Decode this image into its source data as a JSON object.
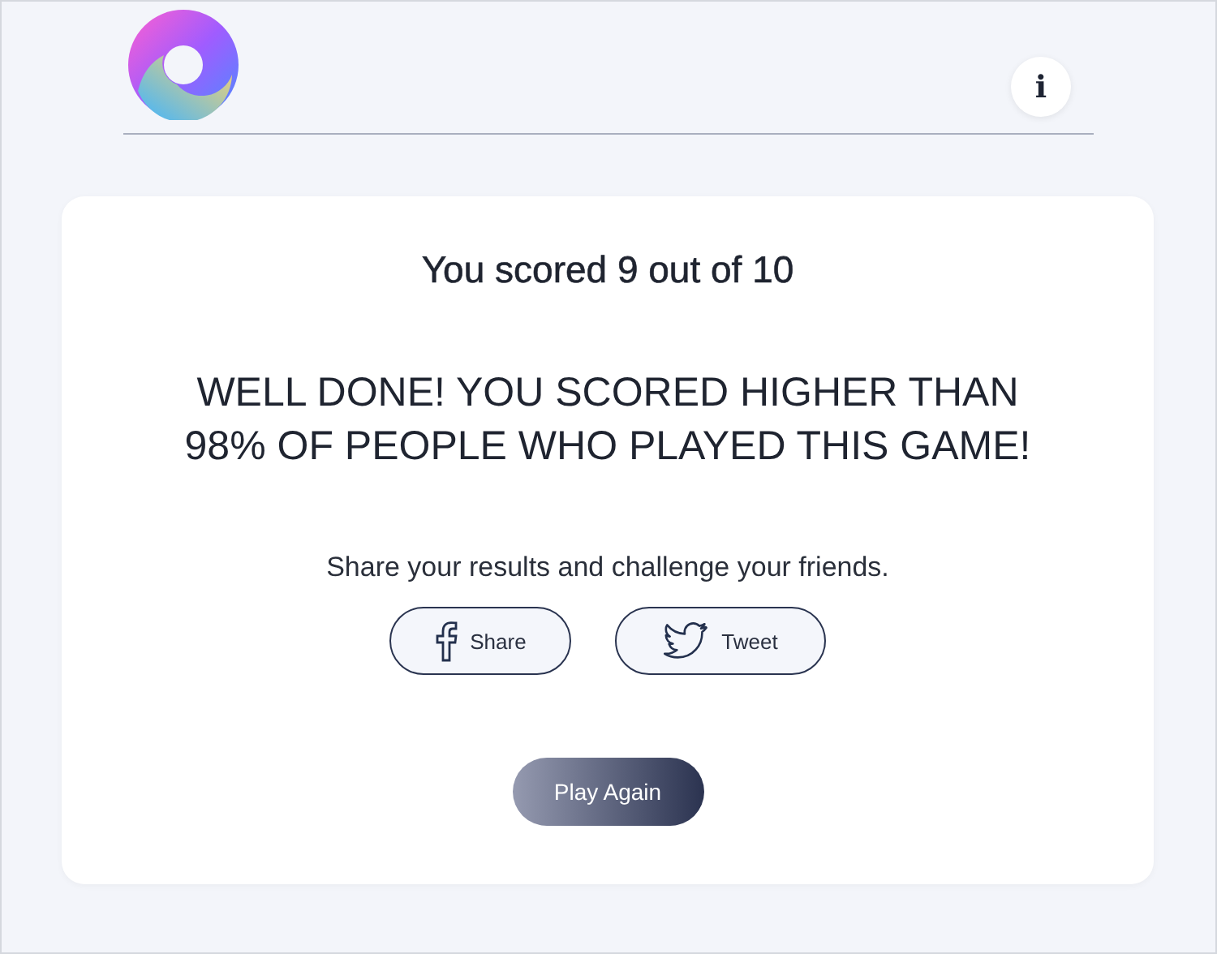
{
  "header": {
    "info_button": "i"
  },
  "result": {
    "score": "You scored 9 out of 10",
    "message_lines": [
      "WELL DONE! YOU SCORED HIGHER THAN",
      "98% OF PEOPLE WHO PLAYED THIS GAME!"
    ]
  },
  "share": {
    "prompt": "Share your results and challenge your friends.",
    "buttons": [
      {
        "kind": "facebook",
        "label": "Share"
      },
      {
        "kind": "twitter",
        "label": "Tweet"
      }
    ]
  },
  "play_again": "Play Again"
}
